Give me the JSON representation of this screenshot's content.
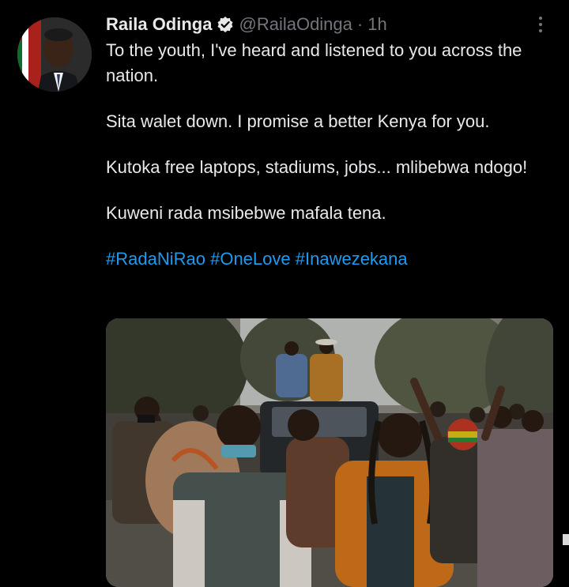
{
  "tweet": {
    "author_name": "Raila Odinga",
    "handle": "@RailaOdinga",
    "separator": "·",
    "time": "1h",
    "verified": true,
    "paragraphs": [
      "To the youth, I've heard and  listened to you across the nation.",
      "Sita walet down. I promise a better Kenya for you.",
      "Kutoka free laptops, stadiums, jobs... mlibebwa ndogo!",
      "Kuweni rada msibebwe mafala tena."
    ],
    "hashtags": [
      "#RadaNiRao",
      "#OneLove",
      "#Inawezekana"
    ]
  },
  "icons": {
    "verified": "verified-badge-icon",
    "more": "more-options-icon"
  },
  "colors": {
    "background": "#000000",
    "text": "#e7e9ea",
    "muted": "#71767b",
    "link": "#1d9bf0"
  }
}
